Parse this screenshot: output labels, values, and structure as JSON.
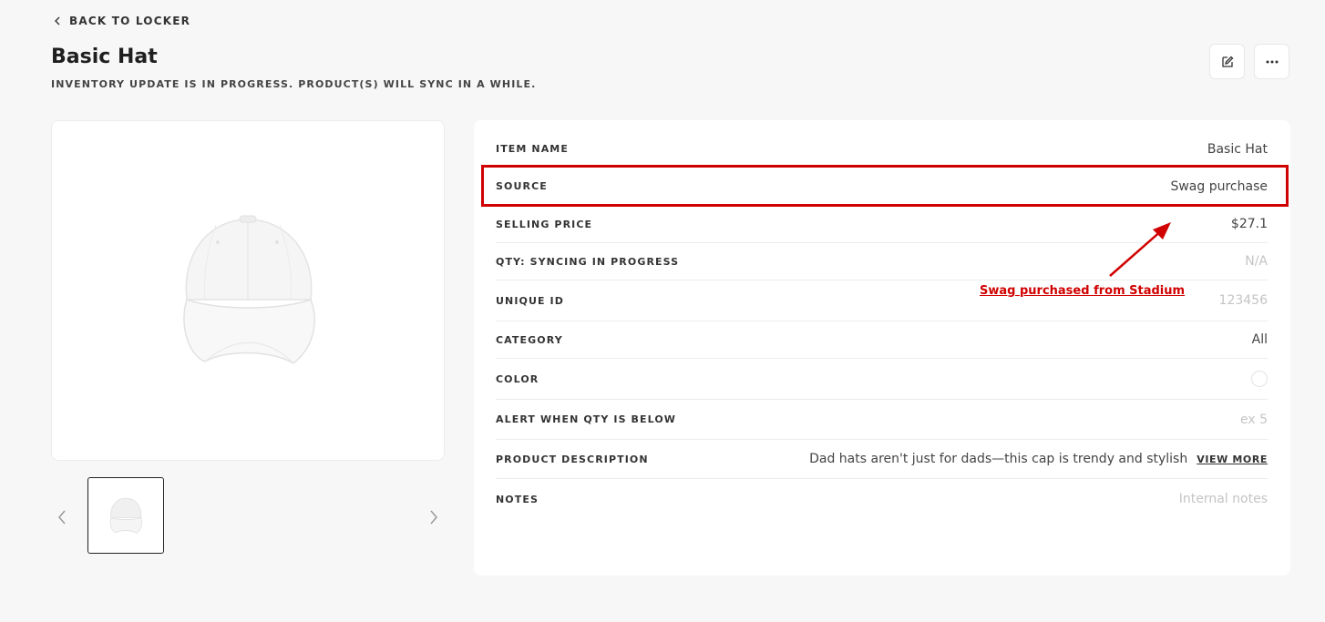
{
  "header": {
    "back_label": "BACK TO LOCKER",
    "title": "Basic Hat",
    "subtitle": "INVENTORY UPDATE IS IN PROGRESS. PRODUCT(S) WILL SYNC IN A WHILE."
  },
  "toolbar": {
    "edit_icon": "edit-icon",
    "more_icon": "more-horizontal-icon"
  },
  "gallery": {
    "main_image": "white-baseball-cap",
    "thumbnail_count": 1
  },
  "details": {
    "item_name": {
      "label": "ITEM NAME",
      "value": "Basic Hat"
    },
    "source": {
      "label": "SOURCE",
      "value": "Swag purchase"
    },
    "selling_price": {
      "label": "SELLING PRICE",
      "value": "$27.1"
    },
    "qty": {
      "label": "QTY: SYNCING IN PROGRESS",
      "value": "N/A"
    },
    "unique_id": {
      "label": "UNIQUE ID",
      "placeholder": "123456"
    },
    "category": {
      "label": "CATEGORY",
      "value": "All"
    },
    "color": {
      "label": "COLOR",
      "swatch_color": "#ffffff"
    },
    "alert_qty": {
      "label": "ALERT WHEN QTY IS BELOW",
      "placeholder": "ex 5"
    },
    "description": {
      "label": "PRODUCT DESCRIPTION",
      "value": "Dad hats aren't just for dads—this cap is trendy and stylish",
      "view_more": "VIEW MORE"
    },
    "notes": {
      "label": "NOTES",
      "placeholder": "Internal notes"
    }
  },
  "annotation": {
    "text": "Swag purchased from Stadium",
    "color": "#d00000"
  }
}
